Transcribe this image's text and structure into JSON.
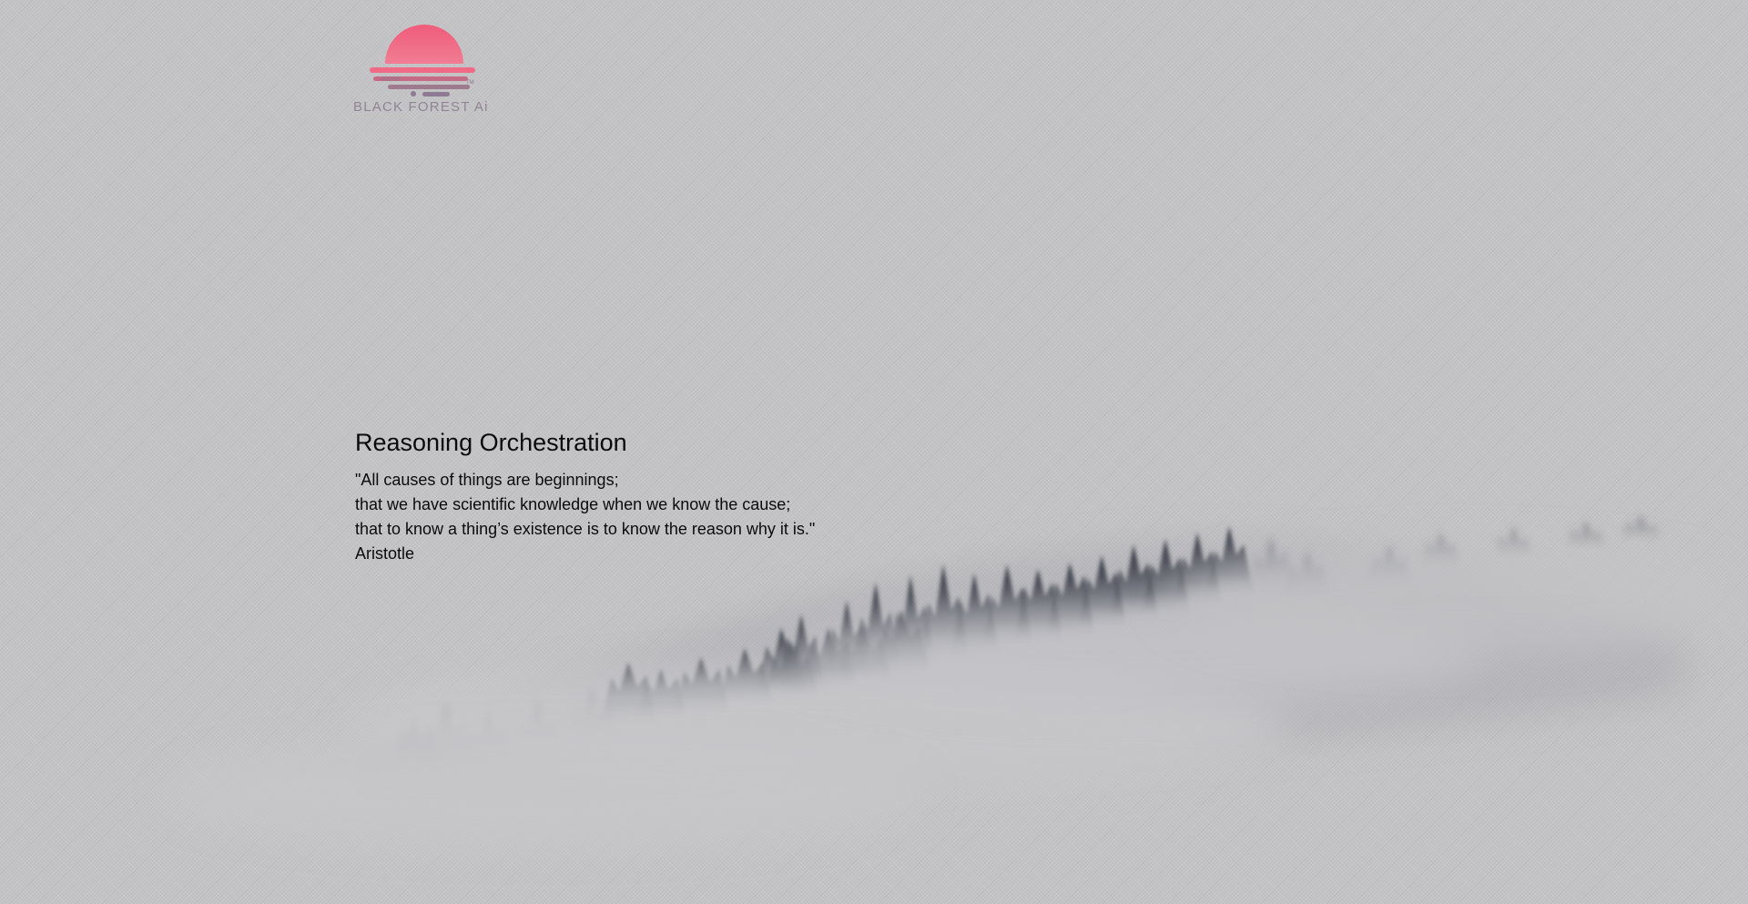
{
  "brand": {
    "name": "BLACK FOREST Ai",
    "logo_icon": "sunset-logo-icon",
    "logo_gradient": [
      "#f0607e",
      "#f07c92"
    ],
    "logo_stripe_color": "#8e7a92"
  },
  "hero": {
    "title": "Reasoning Orchestration",
    "quote_lines": [
      "\"All causes of things are beginnings;",
      "that we have scientific knowledge when we know the cause;",
      "that to know a thing’s existence is to know the reason why it is.\""
    ],
    "attribution": "Aristotle"
  },
  "background": {
    "image": "foggy-forest-illustration",
    "base_color": "#c4c4c6",
    "tree_color": "#2e3340"
  }
}
